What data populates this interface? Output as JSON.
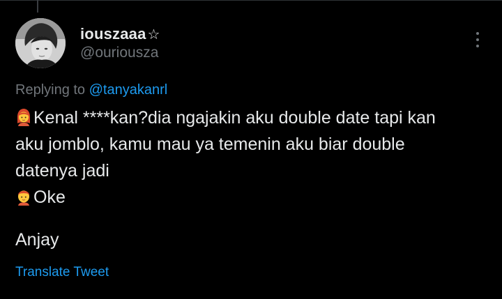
{
  "tweet": {
    "author": {
      "display_name": "iouszaaa",
      "name_symbol": "☆",
      "handle": "@ouriousza",
      "avatar_icon": "avatar-photo"
    },
    "more_icon": "vertical-dots-icon",
    "replying_prefix": "Replying to",
    "replying_handle": "@tanyakanrl",
    "lines": [
      {
        "emoji": "woman-icon",
        "text": "Kenal ****kan?dia ngajakin aku double date tapi kan"
      },
      {
        "emoji": "",
        "text": "aku jomblo, kamu mau ya temenin aku biar double"
      },
      {
        "emoji": "",
        "text": "datenya jadi"
      },
      {
        "emoji": "boy-icon",
        "text": "Oke"
      }
    ],
    "closing_text": "Anjay",
    "translate_label": "Translate Tweet"
  },
  "colors": {
    "background": "#000000",
    "primary_text": "#e7e9ea",
    "secondary_text": "#71767b",
    "link": "#1d9bf0"
  }
}
